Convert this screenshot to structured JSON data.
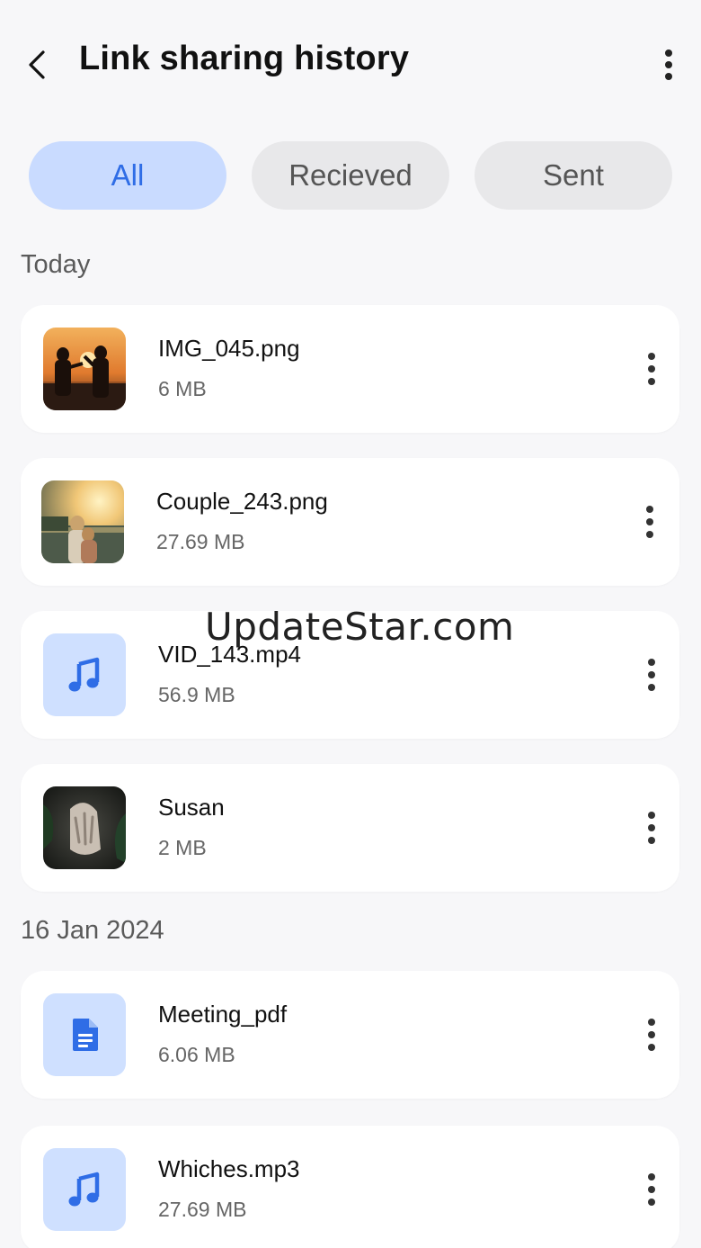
{
  "header": {
    "title": "Link sharing history"
  },
  "tabs": [
    {
      "label": "All",
      "selected": true
    },
    {
      "label": "Recieved",
      "selected": false
    },
    {
      "label": "Sent",
      "selected": false
    }
  ],
  "sections": [
    {
      "label": "Today",
      "items": [
        {
          "name": "IMG_045.png",
          "size": "6 MB",
          "icon": "photo-thumbnail"
        },
        {
          "name": "Couple_243.png",
          "size": "27.69 MB",
          "icon": "photo-thumbnail"
        },
        {
          "name": "VID_143.mp4",
          "size": "56.9 MB",
          "icon": "music-note-icon"
        },
        {
          "name": "Susan",
          "size": "2 MB",
          "icon": "photo-thumbnail"
        }
      ]
    },
    {
      "label": "16 Jan 2024",
      "items": [
        {
          "name": "Meeting_pdf",
          "size": "6.06 MB",
          "icon": "document-icon"
        },
        {
          "name": "Whiches.mp3",
          "size": "27.69 MB",
          "icon": "music-note-icon"
        }
      ]
    }
  ],
  "watermark": "UpdateStar.com",
  "colors": {
    "accent": "#2f6de6",
    "selected_tab_bg": "#c9dbff",
    "tab_bg": "#e8e8ea",
    "icon_tile_bg": "#cfe0ff",
    "background": "#f7f7f9"
  }
}
